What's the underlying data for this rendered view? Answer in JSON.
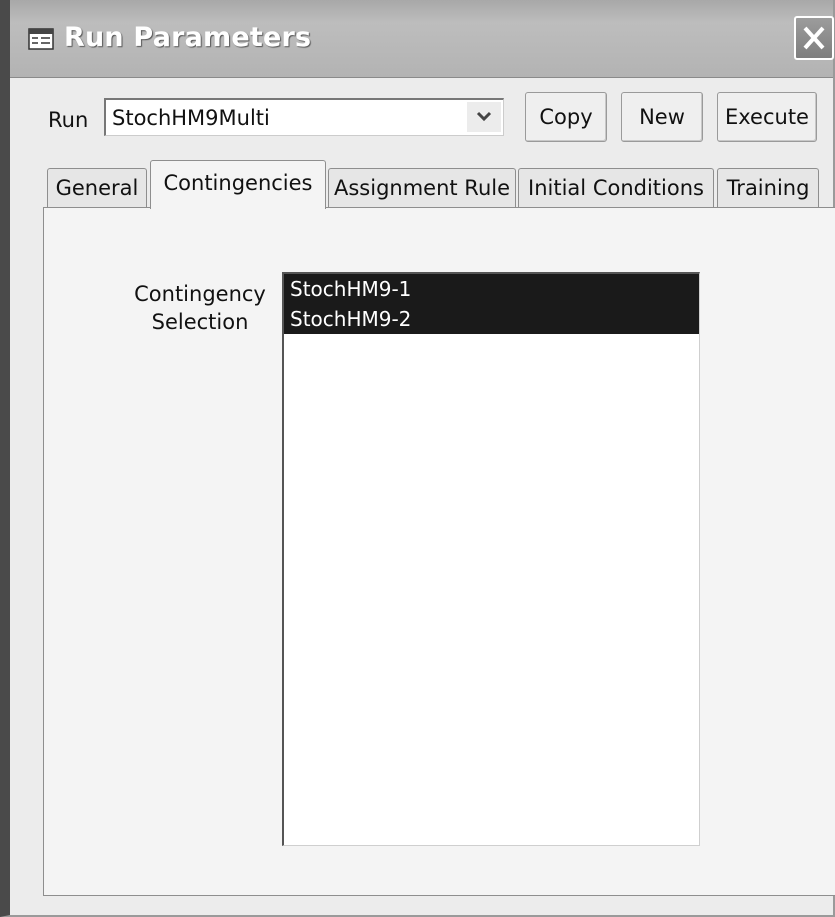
{
  "window": {
    "title": "Run Parameters"
  },
  "run": {
    "label": "Run",
    "selected_value": "StochHM9Multi"
  },
  "toolbar": {
    "copy_label": "Copy",
    "new_label": "New",
    "execute_label": "Execute"
  },
  "tabs": [
    {
      "label": "General",
      "active": false
    },
    {
      "label": "Contingencies",
      "active": true
    },
    {
      "label": "Assignment Rule",
      "active": false
    },
    {
      "label": "Initial Conditions",
      "active": false
    },
    {
      "label": "Training",
      "active": false
    }
  ],
  "contingencies": {
    "label_line1": "Contingency",
    "label_line2": "Selection",
    "items": [
      {
        "label": "StochHM9-1",
        "selected": true
      },
      {
        "label": "StochHM9-2",
        "selected": true
      }
    ]
  },
  "colors": {
    "selection_bg": "#1a1a1a",
    "selection_text": "#ffffff"
  }
}
